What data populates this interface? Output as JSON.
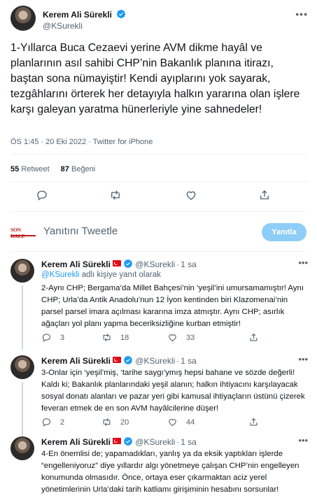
{
  "main_tweet": {
    "author_name": "Kerem Ali Sürekli",
    "handle": "@KSurekli",
    "text": "1-Yıllarca Buca Cezaevi yerine AVM dikme hayâl ve planlarının asıl sahibi CHP’nin Bakanlık planına itirazı, baştan sona nümayiştir! Kendi ayıplarını yok sayarak, tezgâhlarını örterek her detayıyla halkın yararına olan işlere karşı galeyan yaratma hünerleriyle yine sahnedeler!",
    "timestamp": "ÖS 1:45 · 20 Eki 2022 · Twitter for iPhone",
    "retweets_count": "55",
    "retweets_label": "Retweet",
    "likes_count": "87",
    "likes_label": "Beğeni"
  },
  "reply_box": {
    "logo_text": "SON KALE",
    "placeholder": "Yanıtını Tweetle",
    "button_label": "Yanıtla"
  },
  "replies": [
    {
      "author_name": "Kerem Ali Sürekli",
      "handle": "@KSurekli",
      "time": "1 sa",
      "reply_to_user": "@KSurekli",
      "reply_to_suffix": "adlı kişiye yanıt olarak",
      "text": "2-Aynı CHP; Bergama’da Millet Bahçesi’nin ‘yeşil’ini umursamamıştır! Aynı CHP; Urla’da Antik Anadolu’nun 12 İyon kentinden biri Klazomenai’nin parsel parsel imara açılması kararına imza atmıştır. Aynı CHP; asırlık ağaçları yol planı yapma beceriksizliğine kurban etmiştir!",
      "replies": "3",
      "retweets": "18",
      "likes": "33"
    },
    {
      "author_name": "Kerem Ali Sürekli",
      "handle": "@KSurekli",
      "time": "1 sa",
      "text": "3-Onlar için ‘yeşil’miş, ‘tarihe saygı’ymış hepsi bahane ve sözde değerli! Kaldı ki; Bakanlık planlarındaki yeşil alanın; halkın ihtiyacını karşılayacak sosyal donatı alanları ve pazar yeri gibi kamusal ihtiyaçların üstünü çizerek feveran etmek de en son AVM hayâlcilerine düşer!",
      "replies": "2",
      "retweets": "20",
      "likes": "44"
    },
    {
      "author_name": "Kerem Ali Sürekli",
      "handle": "@KSurekli",
      "time": "1 sa",
      "text": "4-En önemlisi de; yapamadıkları, yanlış ya da eksik yaptıkları işlerde “engelleniyoruz” diye yıllardır algı yönetmeye çalışan CHP’nin engelleyen konumunda olmasıdır. Önce, ortaya eser çıkarmaktan aciz yerel yönetimlerinin Urla’daki tarih katliamı girişiminin hesabını sorsunlar!"
    }
  ],
  "colors": {
    "accent": "#1d9bf0",
    "reply_button_disabled": "#8ecdf7",
    "secondary_text": "#536471",
    "flag_red": "#e30a17",
    "logo_red": "#c01818"
  },
  "icons": [
    "verified-badge-icon",
    "turkey-flag-icon",
    "more-options-icon",
    "reply-icon",
    "retweet-icon",
    "like-icon",
    "share-icon"
  ]
}
